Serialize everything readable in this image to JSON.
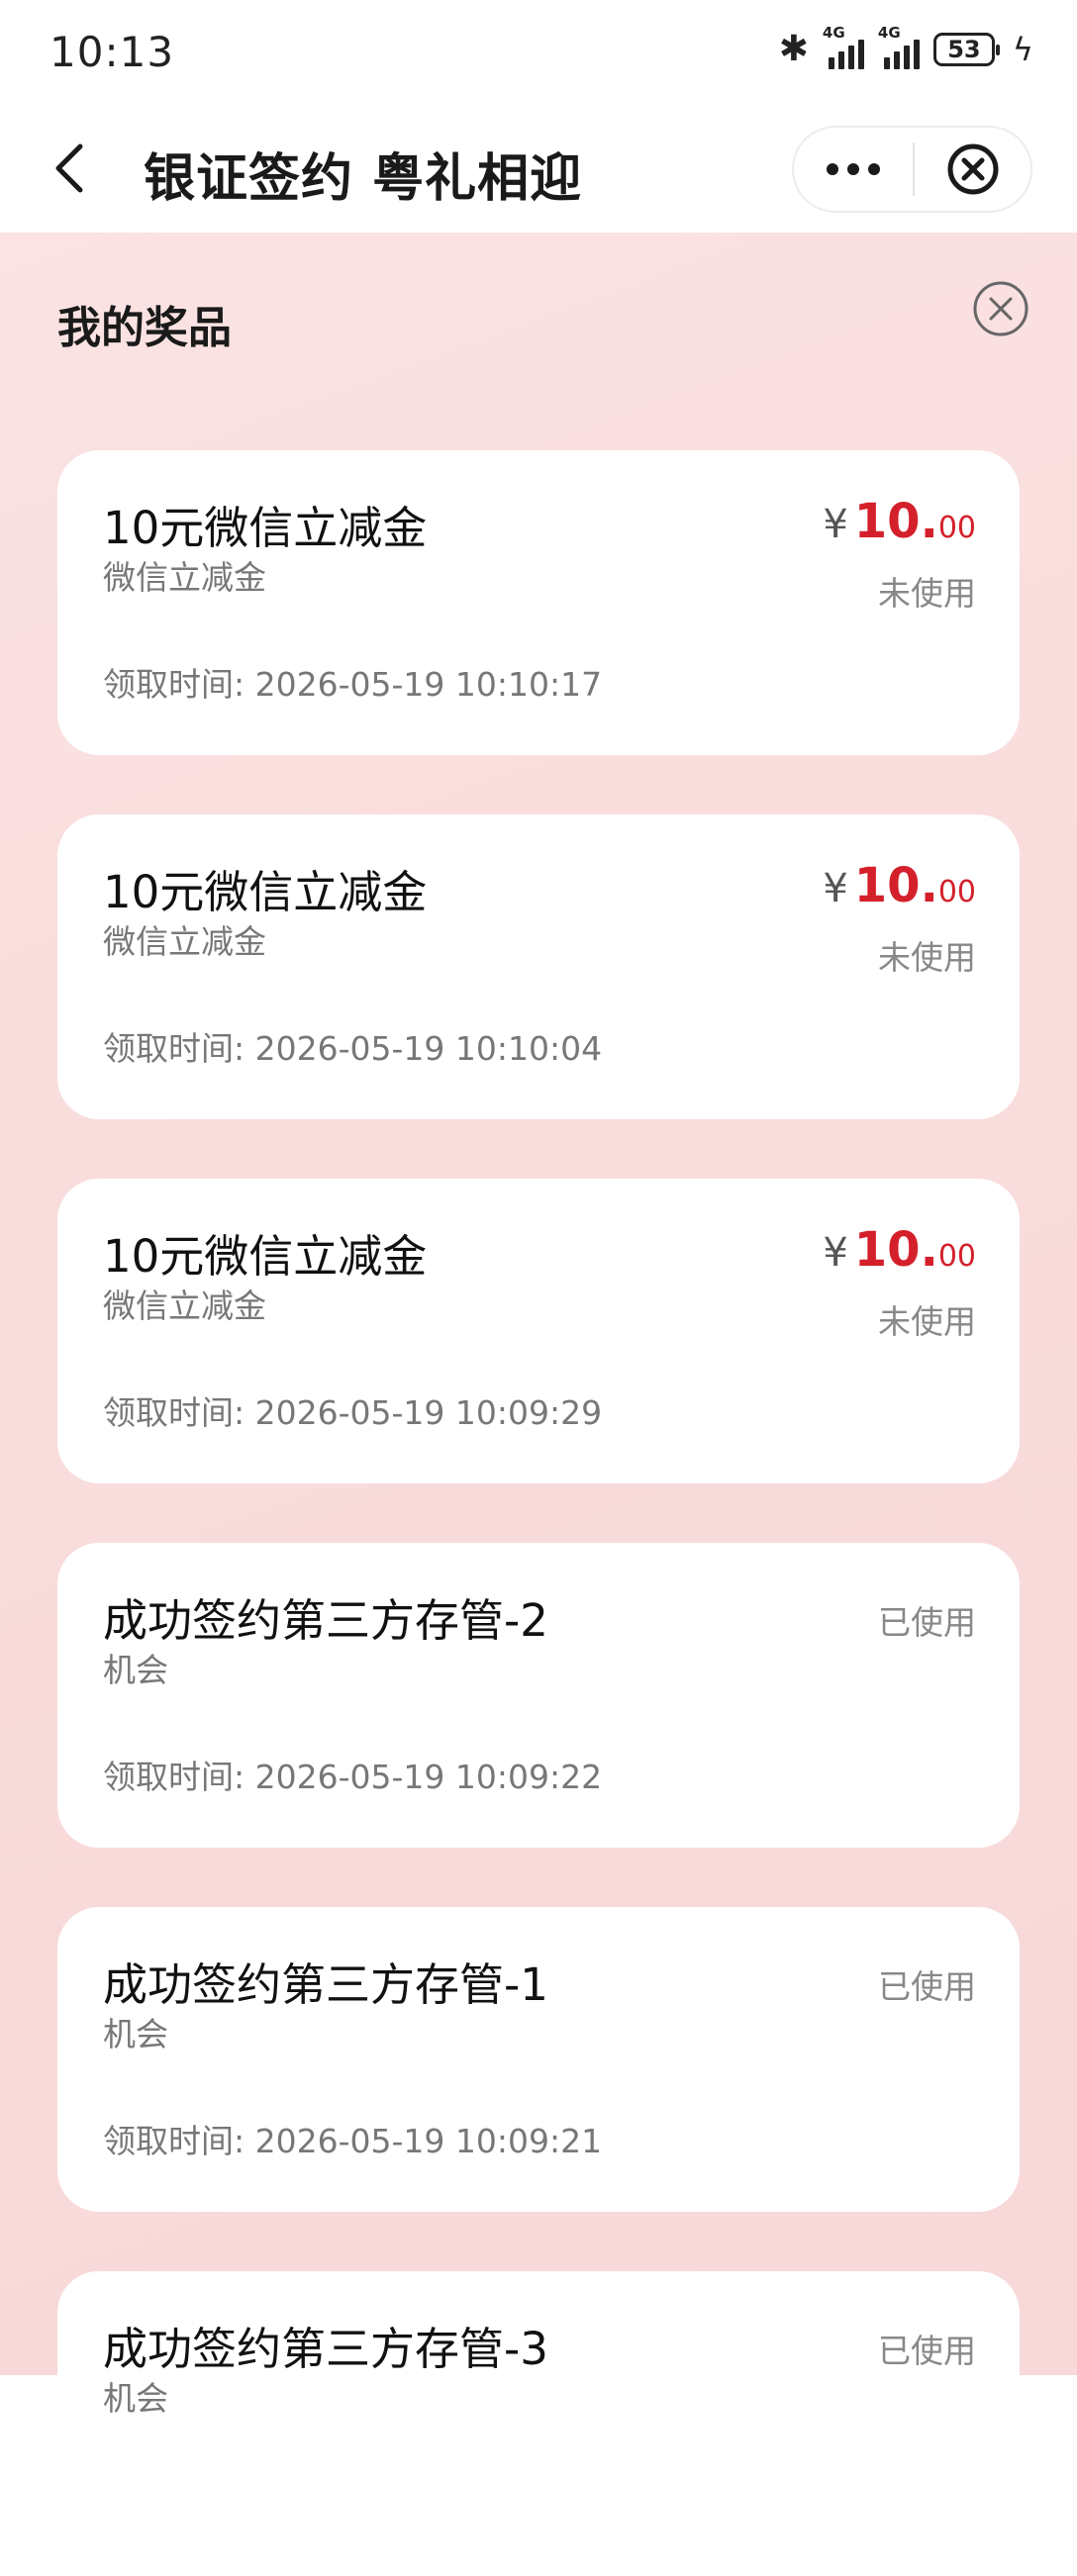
{
  "status_bar": {
    "time": "10:13",
    "signal1_tag": "4G",
    "signal2_tag": "4G",
    "battery": "53"
  },
  "navbar": {
    "title": "银证签约 粤礼相迎"
  },
  "sheet": {
    "title": "我的奖品",
    "time_label": "领取时间: "
  },
  "colors": {
    "price_red": "#d4202b",
    "background_pink": "#f9dcdc"
  },
  "cards": [
    {
      "name": "10元微信立减金",
      "type": "微信立减金",
      "currency": "¥",
      "amount_int": "10.",
      "amount_dec": "00",
      "status": "未使用",
      "time": "2026-05-19 10:10:17"
    },
    {
      "name": "10元微信立减金",
      "type": "微信立减金",
      "currency": "¥",
      "amount_int": "10.",
      "amount_dec": "00",
      "status": "未使用",
      "time": "2026-05-19 10:10:04"
    },
    {
      "name": "10元微信立减金",
      "type": "微信立减金",
      "currency": "¥",
      "amount_int": "10.",
      "amount_dec": "00",
      "status": "未使用",
      "time": "2026-05-19 10:09:29"
    },
    {
      "name": "成功签约第三方存管-2",
      "type": "机会",
      "status": "已使用",
      "time": "2026-05-19 10:09:22"
    },
    {
      "name": "成功签约第三方存管-1",
      "type": "机会",
      "status": "已使用",
      "time": "2026-05-19 10:09:21"
    },
    {
      "name": "成功签约第三方存管-3",
      "type": "机会",
      "status": "已使用",
      "time": ""
    }
  ]
}
